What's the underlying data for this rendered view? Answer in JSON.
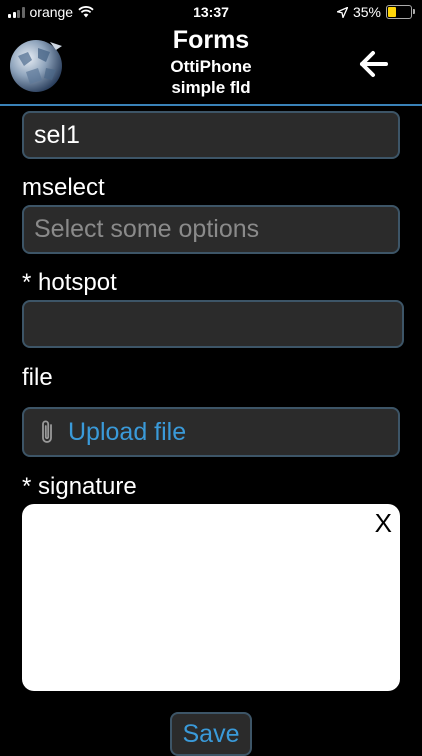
{
  "status_bar": {
    "carrier": "orange",
    "time": "13:37",
    "battery": "35%",
    "battery_level": 0.35,
    "icons": [
      "signal-icon",
      "wifi-icon",
      "location-arrow-icon",
      "battery-icon"
    ]
  },
  "header": {
    "title": "Forms",
    "subtitle1": "OttiPhone",
    "subtitle2": "simple fld",
    "logo_icon": "globe-logo-icon",
    "back_icon": "arrow-left-icon"
  },
  "form": {
    "sel1_value": "sel1",
    "mselect_label": "mselect",
    "mselect_placeholder": "Select some options",
    "hotspot_label": "* hotspot",
    "hotspot_value": "",
    "file_label": "file",
    "upload_label": "Upload file",
    "signature_label": "* signature",
    "signature_clear": "X",
    "save_label": "Save"
  },
  "colors": {
    "accent": "#3a9ad9",
    "header_line": "#3a82b8",
    "field_bg": "#2b2b2b",
    "field_border": "#3d5567",
    "battery": "#ffd60a"
  }
}
